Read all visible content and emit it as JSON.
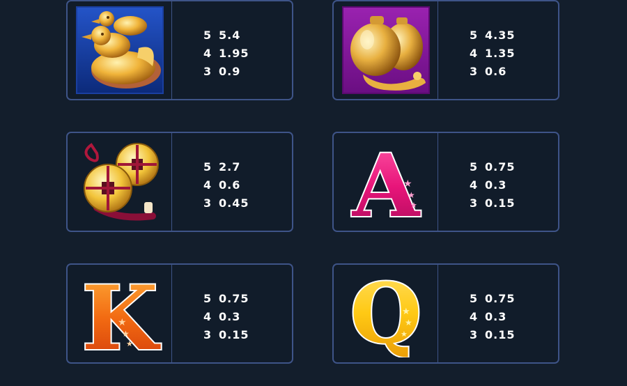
{
  "symbols": [
    {
      "icon": "golden-ducks-icon",
      "pays": [
        {
          "count": "5",
          "amount": "5.4"
        },
        {
          "count": "4",
          "amount": "1.95"
        },
        {
          "count": "3",
          "amount": "0.9"
        }
      ]
    },
    {
      "icon": "golden-pouch-icon",
      "pays": [
        {
          "count": "5",
          "amount": "4.35"
        },
        {
          "count": "4",
          "amount": "1.35"
        },
        {
          "count": "3",
          "amount": "0.6"
        }
      ]
    },
    {
      "icon": "gold-coins-icon",
      "pays": [
        {
          "count": "5",
          "amount": "2.7"
        },
        {
          "count": "4",
          "amount": "0.6"
        },
        {
          "count": "3",
          "amount": "0.45"
        }
      ]
    },
    {
      "icon": "letter-a-icon",
      "letter": "A",
      "pays": [
        {
          "count": "5",
          "amount": "0.75"
        },
        {
          "count": "4",
          "amount": "0.3"
        },
        {
          "count": "3",
          "amount": "0.15"
        }
      ]
    },
    {
      "icon": "letter-k-icon",
      "letter": "K",
      "pays": [
        {
          "count": "5",
          "amount": "0.75"
        },
        {
          "count": "4",
          "amount": "0.3"
        },
        {
          "count": "3",
          "amount": "0.15"
        }
      ]
    },
    {
      "icon": "letter-q-icon",
      "letter": "Q",
      "pays": [
        {
          "count": "5",
          "amount": "0.75"
        },
        {
          "count": "4",
          "amount": "0.3"
        },
        {
          "count": "3",
          "amount": "0.15"
        }
      ]
    }
  ],
  "colors": {
    "background": "#131e2c",
    "card_border": "#3e5488",
    "gold": "#f5c542",
    "pink": "#e8157a",
    "orange": "#f26a12",
    "yellow": "#ffc914"
  }
}
